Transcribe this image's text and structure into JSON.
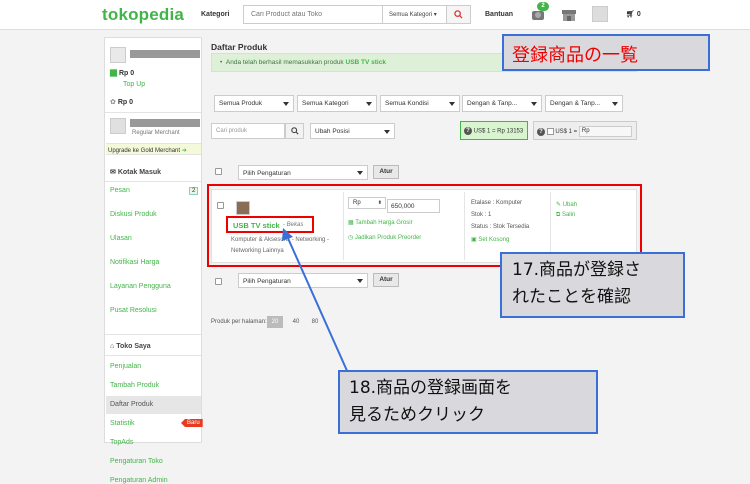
{
  "header": {
    "logo": "tokopedia",
    "kategori": "Kategori",
    "search_placeholder": "Cari Product atau Toko",
    "search_category": "Semua Kategori",
    "bantuan": "Bantuan",
    "notif_count": "2",
    "cart": "0"
  },
  "sidebar": {
    "saldo1": "Rp 0",
    "topup": "Top Up",
    "saldo2": "Rp 0",
    "merchant_label": "Regular Merchant",
    "upgrade": "Upgrade ke Gold Merchant",
    "kotak_masuk": "Kotak Masuk",
    "inbox_items": [
      {
        "label": "Pesan",
        "badge": "2"
      },
      {
        "label": "Diskusi Produk"
      },
      {
        "label": "Ulasan"
      },
      {
        "label": "Notifikasi Harga"
      },
      {
        "label": "Layanan Pengguna"
      },
      {
        "label": "Pusat Resolusi"
      }
    ],
    "toko_saya": "Toko Saya",
    "shop_items": [
      {
        "label": "Penjualan"
      },
      {
        "label": "Tambah Produk"
      },
      {
        "label": "Daftar Produk"
      },
      {
        "label": "Statistik",
        "badge": "Baru"
      },
      {
        "label": "TopAds"
      },
      {
        "label": "Pengaturan Toko"
      },
      {
        "label": "Pengaturan Admin"
      }
    ]
  },
  "main": {
    "title": "Daftar Produk",
    "alert_prefix": "Anda telah berhasil memasukkan produk",
    "alert_product": "USB TV stick",
    "filters": [
      "Semua Produk",
      "Semua Kategori",
      "Semua Kondisi",
      "Dengan & Tanp...",
      "Dengan & Tanp...",
      "Dengan & Tanp..."
    ],
    "product_search_placeholder": "Cari produk",
    "sort": "Ubah Posisi",
    "kurs_green": "US$ 1 = Rp 13153",
    "kurs_grey_label": "US$ 1 =",
    "kurs_grey_value": "Rp",
    "bulk_select": "Pilih Pengaturan",
    "atur": "Atur",
    "per_page_label": "Produk per halaman:",
    "per_page_options": [
      "20",
      "40",
      "80"
    ]
  },
  "product": {
    "name": "USB TV stick",
    "condition": "- Bekas",
    "category": "Komputer & Aksesoris - Networking - Networking Lainnya",
    "currency": "Rp",
    "price": "650,000",
    "grosir": "Tambah Harga Grosir",
    "preorder": "Jadikan Produk Preorder",
    "etalase": "Etalase : Komputer",
    "stok": "Stok : 1",
    "status": "Status : Stok Tersedia",
    "set_kosong": "Set Kosong",
    "ubah": "Ubah",
    "salin": "Salin"
  },
  "annotations": {
    "title_callout": "登録商品の一覧",
    "callout17_l1": "17.商品が登録さ",
    "callout17_l2": "れたことを確認",
    "callout18_l1": "18.商品の登録画面を",
    "callout18_l2": "見るためクリック"
  },
  "colors": {
    "brand_green": "#42b549",
    "annotation_red": "#e00000",
    "annotation_blue": "#3a6fd8"
  }
}
